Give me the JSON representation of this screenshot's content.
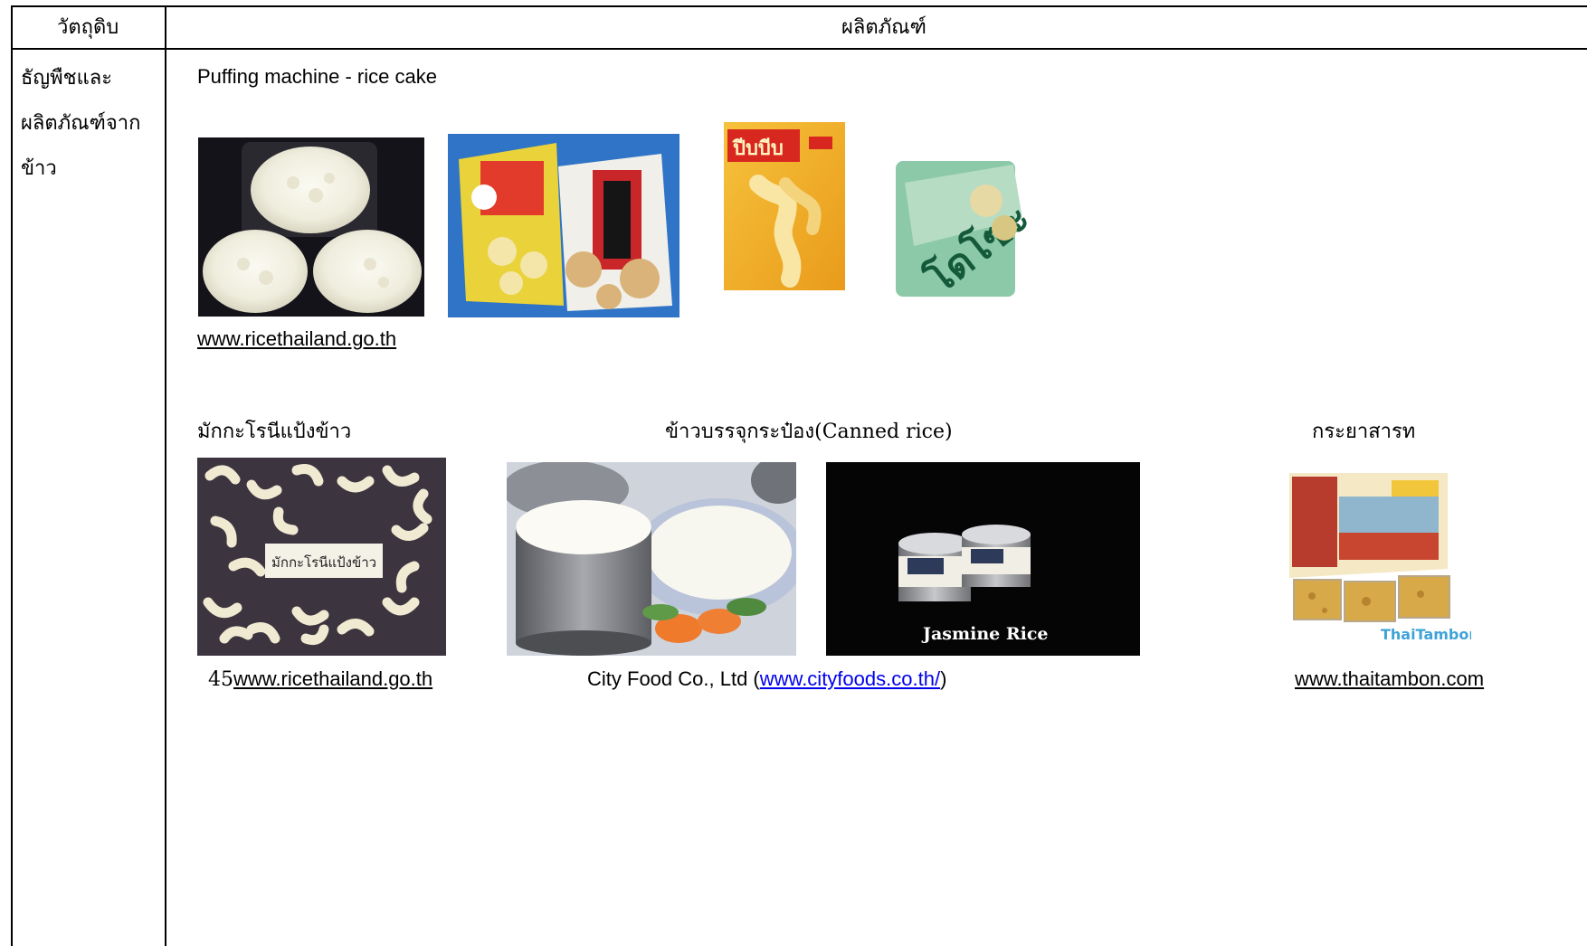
{
  "header": {
    "col1": "วัตถุดิบ",
    "col2": "ผลิตภัณฑ์"
  },
  "category": {
    "line1": "ธัญพืชและ",
    "line2": "ผลิตภัณฑ์จาก",
    "line3": "ข้าว"
  },
  "section1": {
    "title": "Puffing machine - rice cake",
    "source": "www.ricethailand.go.th",
    "packages": [
      {
        "brand": "ปีบบีบ"
      },
      {
        "brand": "โดโซะ"
      }
    ]
  },
  "section2": {
    "macaroni": {
      "title": "มักกะโรนีแป้งข้าว",
      "photo_label": "มักกะโรนีแป้งข้าว",
      "source_prefix": "45",
      "source": "www.ricethailand.go.th"
    },
    "canned": {
      "title": "ข้าวบรรจุกระป๋อง(Canned rice)",
      "photo_caption": "Jasmine Rice",
      "source_prefix": "City Food Co., Ltd (",
      "source_link": "www.cityfoods.co.th/",
      "source_suffix": ")"
    },
    "krayasart": {
      "title": "กระยาสารท",
      "watermark": "ThaiTambon",
      "source": "www.thaitambon.com"
    }
  }
}
